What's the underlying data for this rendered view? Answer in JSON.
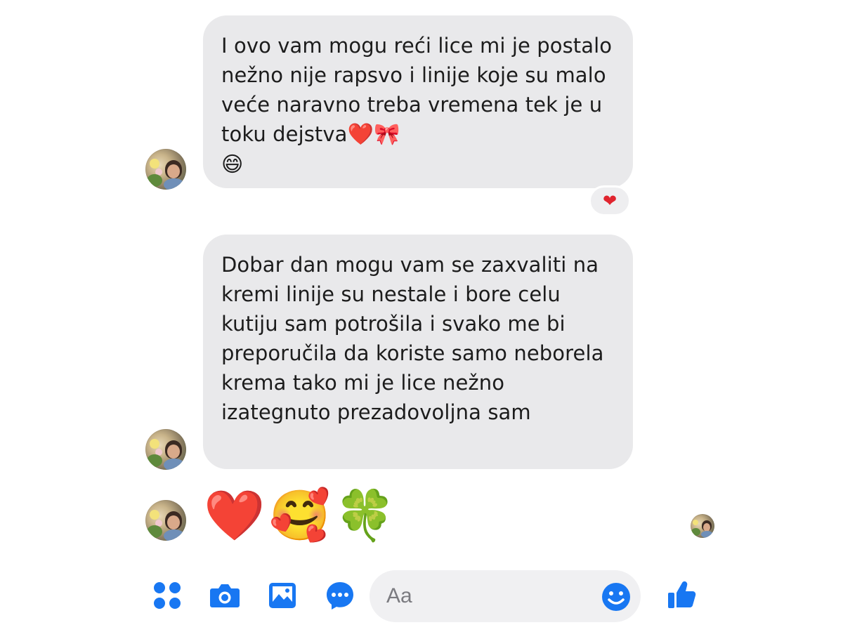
{
  "messages": [
    {
      "text": "I ovo vam mogu reći lice mi je postalo nežno nije rapsvo i linije koje su malo veće naravno treba vremena tek je u toku dejstva",
      "trailing_emojis": "❤️🎀",
      "last_line_emoji": "😄",
      "reaction": "❤"
    },
    {
      "text": "Dobar dan mogu vam se zaxvaliti na kremi linije su nestale i bore celu kutiju sam potrošila i svako me bi preporučila da koriste samo neborela krema tako mi je lice nežno izategnuto prezadovoljna sam"
    },
    {
      "emojis": [
        "❤️",
        "🥰",
        "🍀"
      ]
    }
  ],
  "composer": {
    "placeholder": "Aa",
    "icons": [
      "apps-grid-icon",
      "camera-icon",
      "image-icon",
      "chat-bubble-icon",
      "emoji-smile-icon",
      "thumbs-up-icon"
    ]
  },
  "colors": {
    "bubble": "#e9e9eb",
    "accent": "#1877f2",
    "heart": "#e0242e"
  }
}
